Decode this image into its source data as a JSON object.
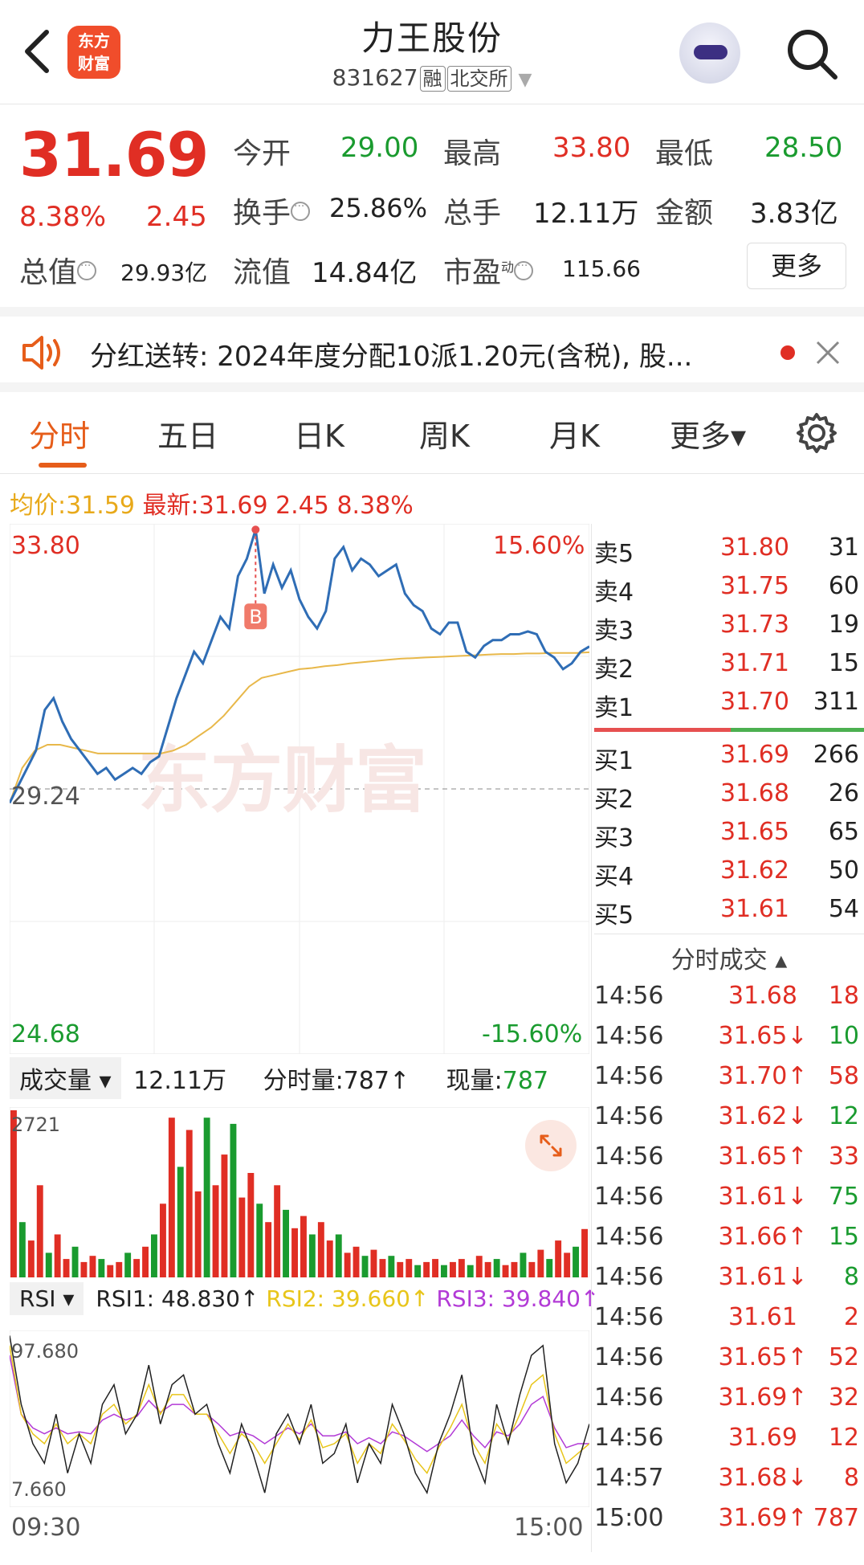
{
  "header": {
    "title": "力王股份",
    "code": "831627",
    "tag_margin": "融",
    "exchange": "北交所",
    "logo_line1": "东方",
    "logo_line2": "财富"
  },
  "quote": {
    "price": "31.69",
    "change_pct": "8.38%",
    "change": "2.45",
    "open_label": "今开",
    "open": "29.00",
    "high_label": "最高",
    "high": "33.80",
    "low_label": "最低",
    "low": "28.50",
    "turnover_label": "换手",
    "turnover": "25.86%",
    "total_hands_label": "总手",
    "total_hands": "12.11万",
    "amount_label": "金额",
    "amount": "3.83亿",
    "mktcap_label": "总值",
    "mktcap": "29.93亿",
    "float_label": "流值",
    "float_val": "14.84亿",
    "pe_label": "市盈",
    "pe_sup": "动",
    "pe": "115.66",
    "more_label": "更多"
  },
  "notice": {
    "text": "分红送转: 2024年度分配10派1.20元(含税), 股..."
  },
  "tabs": [
    "分时",
    "五日",
    "日K",
    "周K",
    "月K",
    "更多▾"
  ],
  "infoline": {
    "avg_label": "均价:",
    "avg": "31.59",
    "latest_label": "最新:",
    "latest": "31.69",
    "change": "2.45",
    "pct": "8.38%"
  },
  "chart_axis": {
    "top_price": "33.80",
    "top_pct": "15.60%",
    "mid_price": "29.24",
    "bottom_price": "24.68",
    "bottom_pct": "-15.60%",
    "watermark": "东方财富",
    "marker_label": "B",
    "vol_max": "2721",
    "rsi_top": "97.680",
    "rsi_bottom": "7.660",
    "time_start": "09:30",
    "time_end": "15:00"
  },
  "volume_bar": {
    "label": "成交量",
    "total": "12.11万",
    "period_label": "分时量:",
    "period": "787",
    "now_label": "现量:",
    "now": "787"
  },
  "rsi_bar": {
    "label": "RSI",
    "rsi1": "RSI1: 48.830",
    "rsi2": "RSI2: 39.660",
    "rsi3": "RSI3: 39.840"
  },
  "order_book": {
    "asks": [
      {
        "label": "卖5",
        "price": "31.80",
        "vol": "31"
      },
      {
        "label": "卖4",
        "price": "31.75",
        "vol": "60"
      },
      {
        "label": "卖3",
        "price": "31.73",
        "vol": "19"
      },
      {
        "label": "卖2",
        "price": "31.71",
        "vol": "15"
      },
      {
        "label": "卖1",
        "price": "31.70",
        "vol": "311"
      }
    ],
    "bids": [
      {
        "label": "买1",
        "price": "31.69",
        "vol": "266"
      },
      {
        "label": "买2",
        "price": "31.68",
        "vol": "26"
      },
      {
        "label": "买3",
        "price": "31.65",
        "vol": "65"
      },
      {
        "label": "买4",
        "price": "31.62",
        "vol": "50"
      },
      {
        "label": "买5",
        "price": "31.61",
        "vol": "54"
      }
    ]
  },
  "trades_header": "分时成交 ▴",
  "trades": [
    {
      "time": "14:56",
      "price": "31.68",
      "dir": "",
      "vol": "18",
      "vc": "red"
    },
    {
      "time": "14:56",
      "price": "31.65↓",
      "dir": "down",
      "vol": "10",
      "vc": "green"
    },
    {
      "time": "14:56",
      "price": "31.70↑",
      "dir": "up",
      "vol": "58",
      "vc": "red"
    },
    {
      "time": "14:56",
      "price": "31.62↓",
      "dir": "down",
      "vol": "12",
      "vc": "green"
    },
    {
      "time": "14:56",
      "price": "31.65↑",
      "dir": "up",
      "vol": "33",
      "vc": "red"
    },
    {
      "time": "14:56",
      "price": "31.61↓",
      "dir": "down",
      "vol": "75",
      "vc": "green"
    },
    {
      "time": "14:56",
      "price": "31.66↑",
      "dir": "up",
      "vol": "15",
      "vc": "green"
    },
    {
      "time": "14:56",
      "price": "31.61↓",
      "dir": "down",
      "vol": "8",
      "vc": "green"
    },
    {
      "time": "14:56",
      "price": "31.61",
      "dir": "",
      "vol": "2",
      "vc": "red"
    },
    {
      "time": "14:56",
      "price": "31.65↑",
      "dir": "up",
      "vol": "52",
      "vc": "red"
    },
    {
      "time": "14:56",
      "price": "31.69↑",
      "dir": "up",
      "vol": "32",
      "vc": "red"
    },
    {
      "time": "14:56",
      "price": "31.69",
      "dir": "",
      "vol": "12",
      "vc": "red"
    },
    {
      "time": "14:57",
      "price": "31.68↓",
      "dir": "down",
      "vol": "8",
      "vc": "red"
    },
    {
      "time": "15:00",
      "price": "31.69↑",
      "dir": "up",
      "vol": "787",
      "vc": "red"
    }
  ],
  "colors": {
    "up": "#e02e24",
    "down": "#1a9b2f",
    "price_line": "#2f6db5",
    "avg_line": "#e8b84a",
    "accent": "#e65d1a",
    "rsi1": "#222222",
    "rsi2": "#e8c51a",
    "rsi3": "#b23ad6"
  },
  "chart_data": {
    "type": "line",
    "y_range": [
      24.68,
      33.8
    ],
    "prev_close": 29.24,
    "x_range": [
      "09:30",
      "15:00"
    ],
    "series": [
      {
        "values": [
          29.0,
          29.3,
          29.6,
          29.9,
          30.6,
          30.8,
          30.4,
          30.1,
          29.9,
          29.7,
          29.5,
          29.6,
          29.4,
          29.5,
          29.6,
          29.5,
          29.7,
          29.8,
          30.3,
          30.8,
          31.2,
          31.6,
          31.4,
          31.8,
          32.2,
          32.0,
          32.9,
          33.2,
          33.7,
          32.6,
          33.1,
          32.7,
          33.0,
          32.5,
          32.2,
          32.0,
          32.3,
          33.2,
          33.4,
          33.0,
          33.2,
          33.1,
          32.9,
          33.0,
          33.1,
          32.6,
          32.4,
          32.3,
          32.0,
          31.9,
          32.1,
          32.1,
          31.6,
          31.5,
          31.7,
          31.8,
          31.8,
          31.9,
          31.9,
          31.95,
          31.9,
          31.6,
          31.5,
          31.3,
          31.4,
          31.6,
          31.69
        ]
      },
      {
        "values": [
          29.0,
          29.6,
          29.9,
          30.0,
          30.0,
          29.95,
          29.9,
          29.85,
          29.85,
          29.85,
          29.85,
          29.85,
          29.85,
          29.9,
          30.0,
          30.15,
          30.3,
          30.5,
          30.75,
          31.0,
          31.15,
          31.2,
          31.25,
          31.3,
          31.32,
          31.35,
          31.37,
          31.4,
          31.42,
          31.44,
          31.46,
          31.48,
          31.49,
          31.5,
          31.51,
          31.52,
          31.53,
          31.54,
          31.55,
          31.56,
          31.56,
          31.57,
          31.57,
          31.58,
          31.58,
          31.58,
          31.59
        ]
      }
    ],
    "volume": [
      2721,
      900,
      600,
      1500,
      400,
      700,
      300,
      500,
      250,
      350,
      300,
      200,
      250,
      400,
      300,
      500,
      700,
      1200,
      2600,
      1800,
      2400,
      1400,
      2600,
      1500,
      2000,
      2500,
      1300,
      1700,
      1200,
      900,
      1500,
      1100,
      800,
      1000,
      700,
      900,
      600,
      700,
      400,
      500,
      350,
      450,
      300,
      350,
      250,
      300,
      200,
      250,
      300,
      200,
      250,
      300,
      200,
      350,
      250,
      300,
      200,
      250,
      400,
      250,
      450,
      300,
      600,
      400,
      500,
      787
    ],
    "rsi": [
      {
        "name": "RSI1",
        "values": [
          95,
          60,
          40,
          30,
          55,
          25,
          45,
          30,
          60,
          70,
          45,
          55,
          80,
          50,
          70,
          75,
          55,
          60,
          40,
          25,
          50,
          35,
          15,
          45,
          55,
          40,
          60,
          30,
          35,
          50,
          20,
          40,
          30,
          60,
          45,
          25,
          15,
          40,
          55,
          75,
          35,
          20,
          60,
          40,
          65,
          85,
          90,
          40,
          20,
          30,
          50
        ]
      },
      {
        "name": "RSI2",
        "values": [
          90,
          55,
          45,
          40,
          50,
          40,
          45,
          40,
          55,
          60,
          50,
          55,
          70,
          55,
          65,
          65,
          55,
          55,
          45,
          35,
          45,
          40,
          30,
          40,
          50,
          42,
          52,
          38,
          40,
          45,
          30,
          40,
          35,
          50,
          42,
          32,
          25,
          38,
          48,
          60,
          40,
          30,
          50,
          42,
          55,
          70,
          75,
          45,
          30,
          35,
          40
        ]
      },
      {
        "name": "RSI3",
        "values": [
          85,
          55,
          48,
          45,
          48,
          45,
          46,
          45,
          52,
          55,
          52,
          54,
          62,
          56,
          60,
          60,
          55,
          55,
          50,
          44,
          46,
          44,
          40,
          44,
          48,
          45,
          50,
          44,
          44,
          46,
          40,
          43,
          40,
          46,
          44,
          40,
          36,
          40,
          44,
          52,
          44,
          38,
          46,
          44,
          50,
          60,
          64,
          48,
          38,
          40,
          40
        ]
      }
    ],
    "rsi_range": [
      7.66,
      97.68
    ]
  }
}
